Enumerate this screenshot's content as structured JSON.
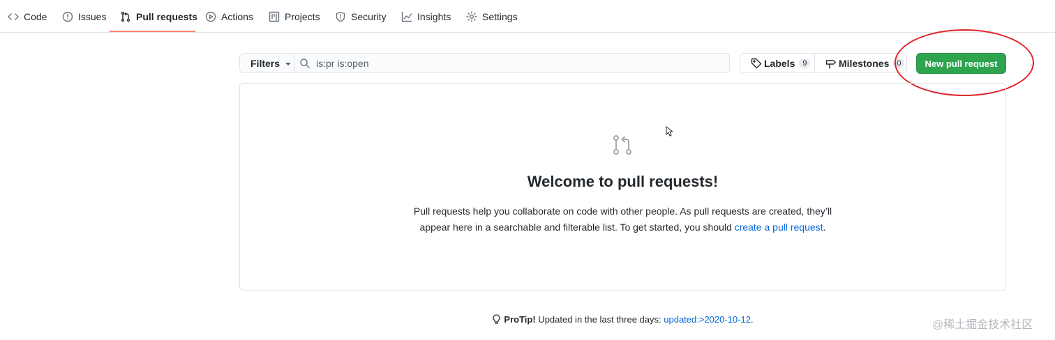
{
  "tabs": [
    {
      "label": "Code",
      "icon": "code-icon"
    },
    {
      "label": "Issues",
      "icon": "issue-icon"
    },
    {
      "label": "Pull requests",
      "icon": "pull-request-icon",
      "selected": true
    },
    {
      "label": "Actions",
      "icon": "play-icon"
    },
    {
      "label": "Projects",
      "icon": "project-icon"
    },
    {
      "label": "Security",
      "icon": "shield-icon"
    },
    {
      "label": "Insights",
      "icon": "graph-icon"
    },
    {
      "label": "Settings",
      "icon": "gear-icon"
    }
  ],
  "subnav": {
    "filters_label": "Filters",
    "search_value": "is:pr is:open",
    "labels": {
      "label": "Labels",
      "count": "9"
    },
    "milestones": {
      "label": "Milestones",
      "count": "0"
    },
    "new_button": "New pull request"
  },
  "blankslate": {
    "title": "Welcome to pull requests!",
    "text_before": "Pull requests help you collaborate on code with other people. As pull requests are created, they’ll appear here in a searchable and filterable list. To get started, you should ",
    "link_text": "create a pull request",
    "text_after": "."
  },
  "protip": {
    "strong": "ProTip!",
    "text": " Updated in the last three days: ",
    "link": "updated:>2020-10-12",
    "end": "."
  },
  "watermark": "@稀土掘金技术社区",
  "colors": {
    "accent_tab": "#f9826c",
    "primary_button": "#2ea44f",
    "link": "#0366d6",
    "annotation": "#e0242a"
  }
}
